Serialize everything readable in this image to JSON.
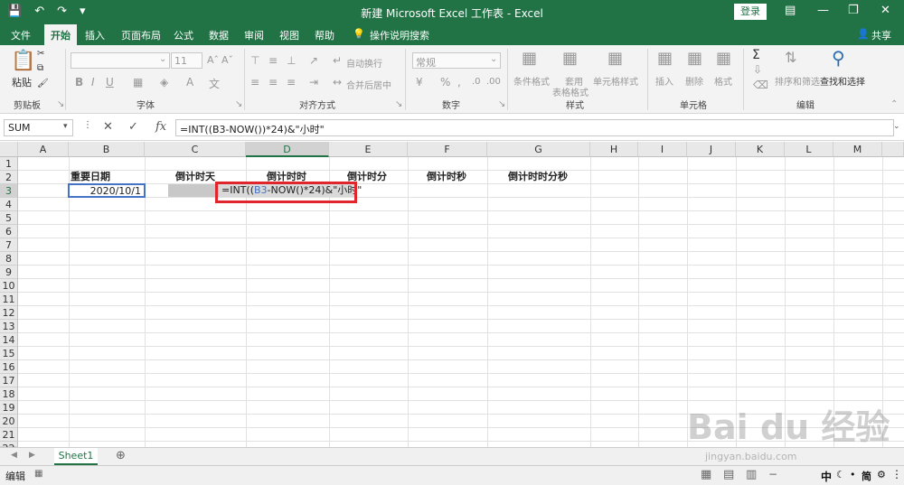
{
  "window": {
    "title": "新建 Microsoft Excel 工作表 - Excel",
    "login_label": "登录"
  },
  "ribbon_tabs": [
    "文件",
    "开始",
    "插入",
    "页面布局",
    "公式",
    "数据",
    "审阅",
    "视图",
    "帮助",
    "操作说明搜索"
  ],
  "share_label": "共享",
  "ribbon": {
    "paste": "粘贴",
    "clipboard": "剪贴板",
    "font": "字体",
    "font_size": "11",
    "alignment": "对齐方式",
    "wrap": "自动换行",
    "merge": "合并后居中",
    "number": "数字",
    "number_format": "常规",
    "styles": "样式",
    "cond_format": "条件格式",
    "table_format_1": "套用",
    "table_format_2": "表格格式",
    "cell_styles": "单元格样式",
    "cells": "单元格",
    "insert": "插入",
    "delete": "删除",
    "format": "格式",
    "editing": "编辑",
    "sort": "排序和筛选",
    "find": "查找和选择"
  },
  "formula_bar": {
    "name_box": "SUM",
    "formula": "=INT((B3-NOW())*24)&\"小时\""
  },
  "columns": [
    "A",
    "B",
    "C",
    "D",
    "E",
    "F",
    "G",
    "H",
    "I",
    "J",
    "K",
    "L",
    "M"
  ],
  "rows": [
    "1",
    "2",
    "3",
    "4",
    "5",
    "6",
    "7",
    "8",
    "9",
    "10",
    "11",
    "12",
    "13",
    "14",
    "15",
    "16",
    "17",
    "18",
    "19",
    "20",
    "21",
    "22"
  ],
  "cells": {
    "B2": "重要日期",
    "C2": "倒计时天",
    "D2": "倒计时时",
    "E2": "倒计时分",
    "F2": "倒计时秒",
    "G2": "倒计时时分秒",
    "B3": "2020/10/1",
    "D3_parts": [
      "=INT((",
      "B3",
      "-NOW(",
      ")",
      "*24)&\"小时\""
    ]
  },
  "sheet_tab": "Sheet1",
  "status": {
    "mode": "编辑",
    "ime": "中"
  },
  "colors": {
    "excel_green": "#217346",
    "highlight_red": "#e0262c",
    "ref_blue": "#4472c4"
  },
  "watermark": {
    "brand": "Bai du 经验",
    "url": "jingyan.baidu.com"
  }
}
